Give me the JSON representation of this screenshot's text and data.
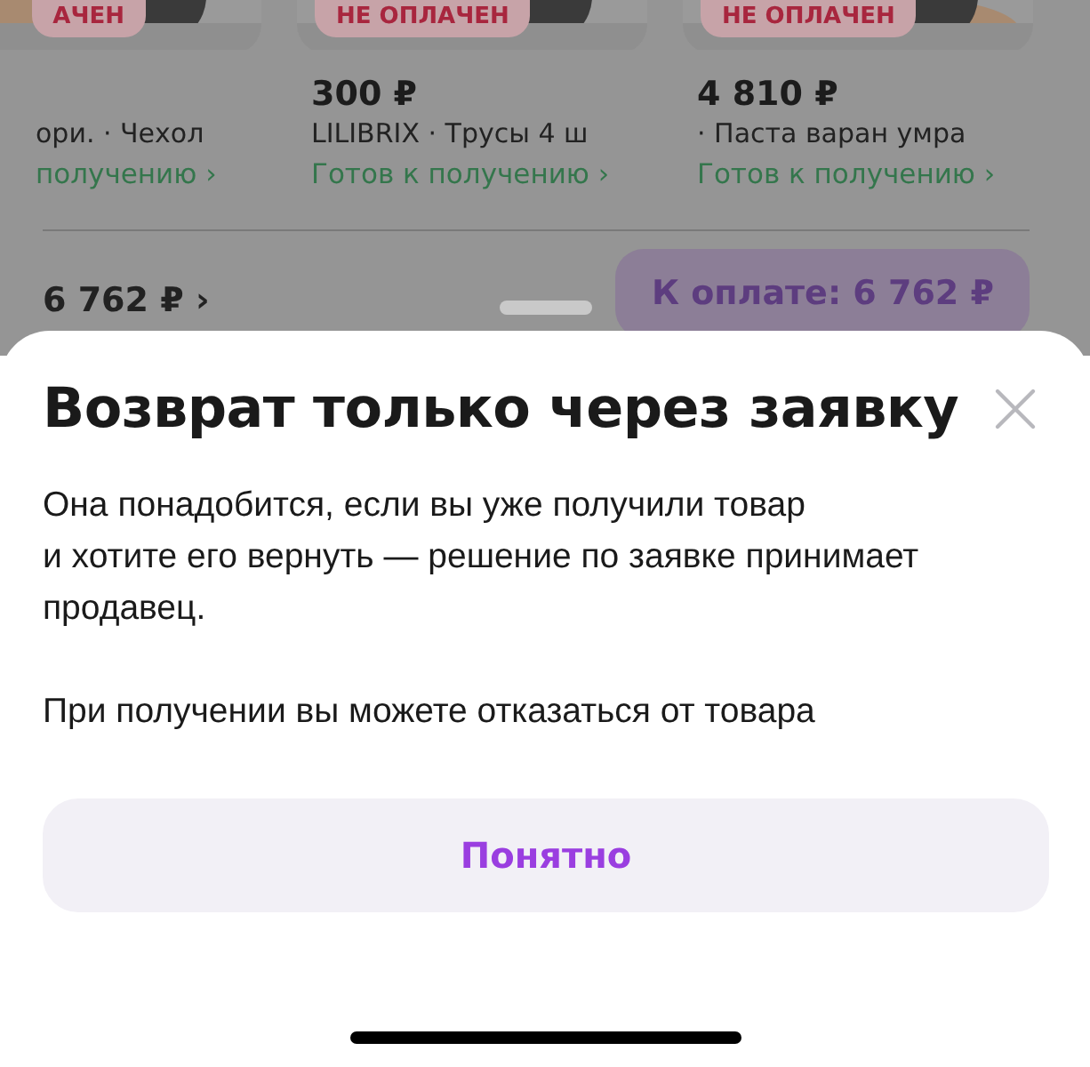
{
  "background": {
    "products": [
      {
        "badge": "АЧЕН",
        "title": "ори. · Чехол",
        "status": "получению ›"
      },
      {
        "badge": "НЕ ОПЛАЧЕН",
        "price": "300 ₽",
        "title": "LILIBRIX · Трусы 4 ш",
        "status": "Готов к получению ›"
      },
      {
        "badge": "НЕ ОПЛАЧЕН",
        "price": "4 810 ₽",
        "title": " · Паста варан умра",
        "status": "Готов к получению ›"
      }
    ],
    "total": "6 762 ₽ ›",
    "pay_button": "К оплате: 6 762 ₽"
  },
  "sheet": {
    "title": "Возврат только через заявку",
    "paragraphs": [
      "Она понадобится, если вы уже получили товар\nи хотите его вернуть — решение по заявке принимает продавец.",
      "При получении вы можете отказаться от товара"
    ],
    "button": "Понятно"
  }
}
